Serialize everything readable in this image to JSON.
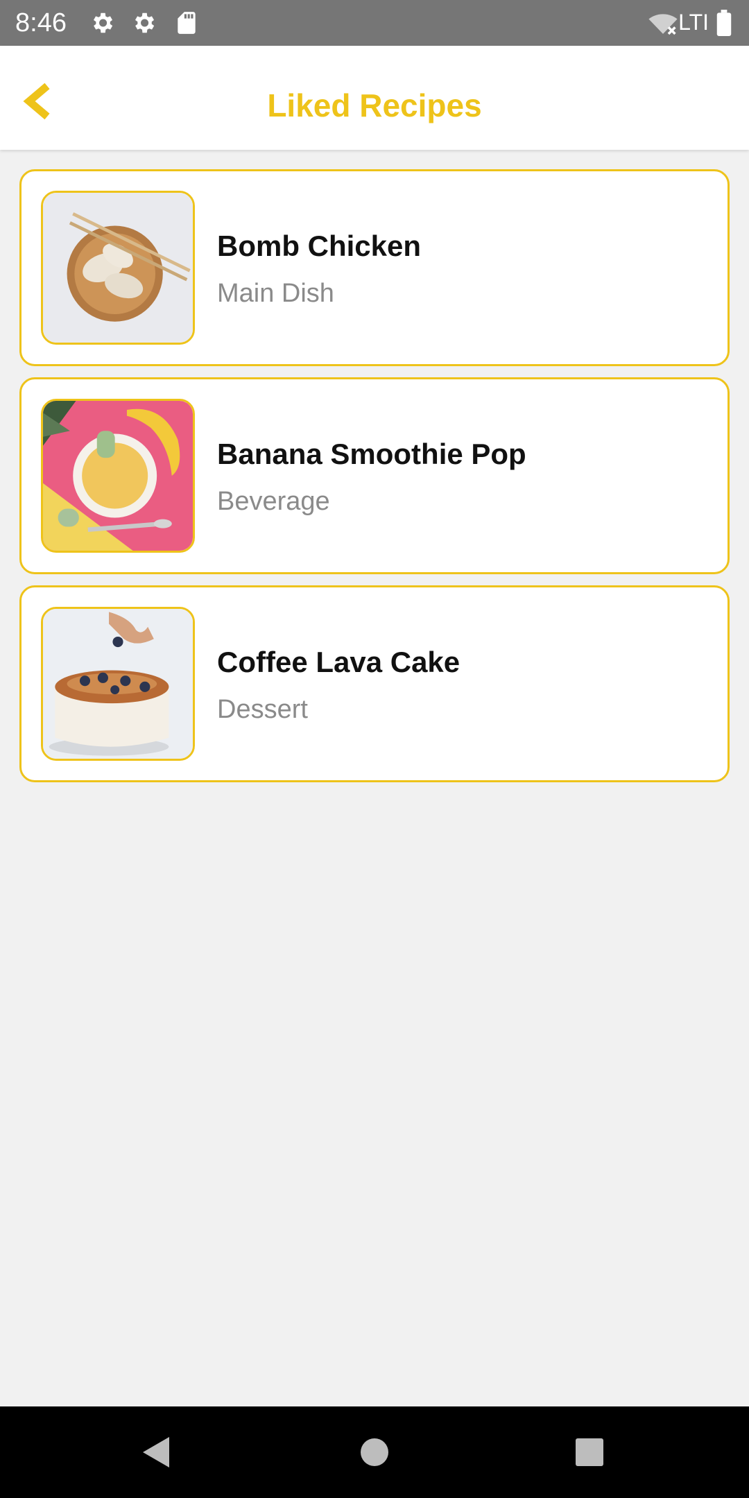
{
  "status_bar": {
    "time": "8:46",
    "network_label": "LTI",
    "icons": [
      "settings-icon",
      "settings-icon",
      "sd-card-icon",
      "wifi-off-icon",
      "battery-icon"
    ]
  },
  "app_bar": {
    "title": "Liked Recipes",
    "back_icon": "chevron-left-icon"
  },
  "colors": {
    "accent": "#eec31a",
    "background": "#f1f1f1",
    "subtitle": "#8a8a8a"
  },
  "recipes": [
    {
      "title": "Bomb Chicken",
      "category": "Main Dish",
      "image": "dumplings-photo"
    },
    {
      "title": "Banana Smoothie Pop",
      "category": "Beverage",
      "image": "banana-smoothie-photo"
    },
    {
      "title": "Coffee Lava Cake",
      "category": "Dessert",
      "image": "blueberry-cake-photo"
    }
  ],
  "nav_bar": {
    "back": "triangle-back-icon",
    "home": "circle-home-icon",
    "recents": "square-recents-icon"
  }
}
